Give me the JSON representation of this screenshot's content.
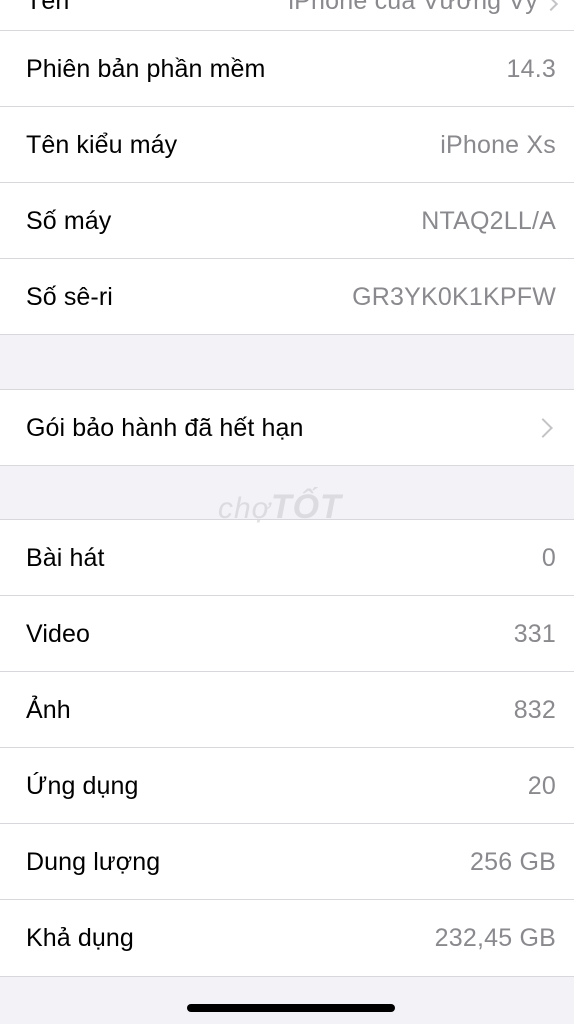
{
  "top_row": {
    "label": "Tên",
    "value": "iPhone của Vương Vỹ"
  },
  "info_rows": [
    {
      "label": "Phiên bản phần mềm",
      "value": "14.3"
    },
    {
      "label": "Tên kiểu máy",
      "value": "iPhone Xs"
    },
    {
      "label": "Số máy",
      "value": "NTAQ2LL/A"
    },
    {
      "label": "Số sê-ri",
      "value": "GR3YK0K1KPFW"
    }
  ],
  "warranty_row": {
    "label": "Gói bảo hành đã hết hạn",
    "icon": "chevron-right-icon"
  },
  "stats_rows": [
    {
      "label": "Bài hát",
      "value": "0"
    },
    {
      "label": "Video",
      "value": "331"
    },
    {
      "label": "Ảnh",
      "value": "832"
    },
    {
      "label": "Ứng dụng",
      "value": "20"
    },
    {
      "label": "Dung lượng",
      "value": "256 GB"
    },
    {
      "label": "Khả dụng",
      "value": "232,45 GB"
    }
  ],
  "watermark": {
    "prefix": "chợ",
    "suffix": "TỐT"
  },
  "colors": {
    "background": "#f2f2f7",
    "cell": "#ffffff",
    "value_text": "#8a8a8e",
    "separator": "#d8d8dc"
  }
}
